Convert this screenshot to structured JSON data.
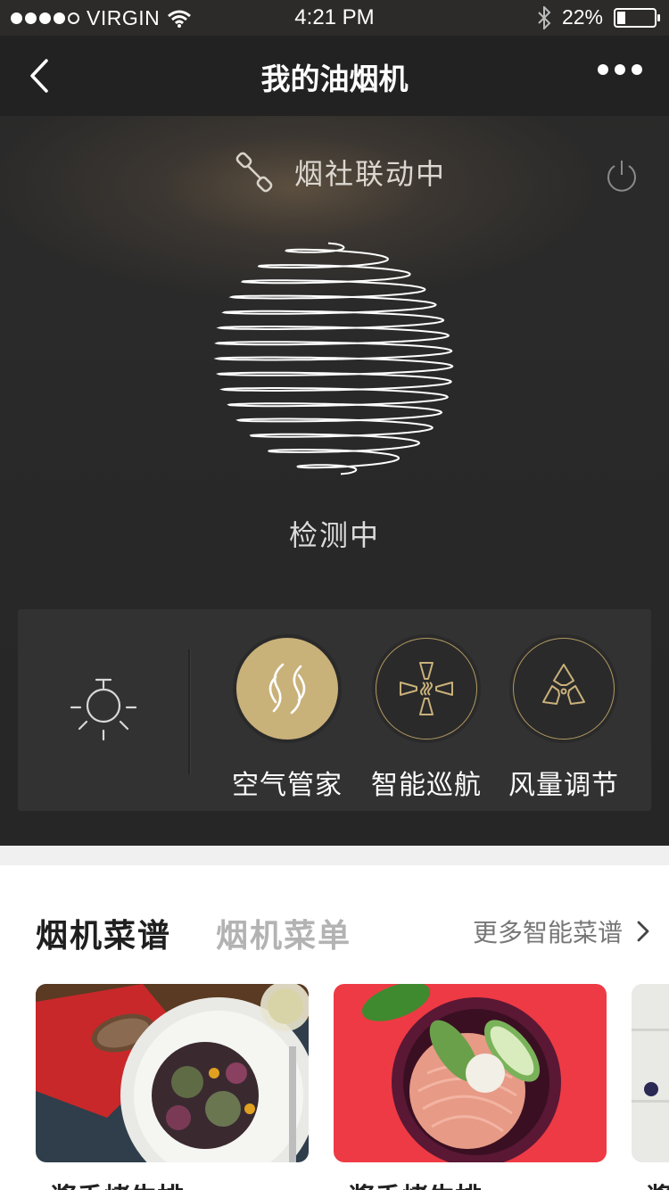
{
  "status_bar": {
    "carrier": "VIRGIN",
    "time": "4:21 PM",
    "battery": "22%",
    "battery_level": 0.22,
    "signal_bars": 4
  },
  "nav": {
    "title": "我的油烟机",
    "back_icon": "chevron-left-icon",
    "more_icon": "more-dots-icon"
  },
  "link": {
    "icon": "link-chain-icon",
    "text": "烟社联动中"
  },
  "power_icon": "power-icon",
  "status_text": "检测中",
  "controls": {
    "light_icon": "lamp-icon",
    "modes": [
      {
        "label": "空气管家",
        "icon": "air-steward-icon",
        "active": true
      },
      {
        "label": "智能巡航",
        "icon": "smart-cruise-icon",
        "active": false
      },
      {
        "label": "风量调节",
        "icon": "fan-icon",
        "active": false
      }
    ],
    "accent_color": "#c9b17a"
  },
  "recipes": {
    "tabs": [
      {
        "label": "烟机菜谱",
        "active": true
      },
      {
        "label": "烟机菜单",
        "active": false
      }
    ],
    "more_label": "更多智能菜谱",
    "cards": [
      {
        "title": "酱香烤牛排",
        "image": "salad-plate-photo"
      },
      {
        "title": "酱香烤牛排",
        "image": "noodle-bowl-photo"
      },
      {
        "title": "酱",
        "image": "white-table-photo"
      }
    ]
  }
}
